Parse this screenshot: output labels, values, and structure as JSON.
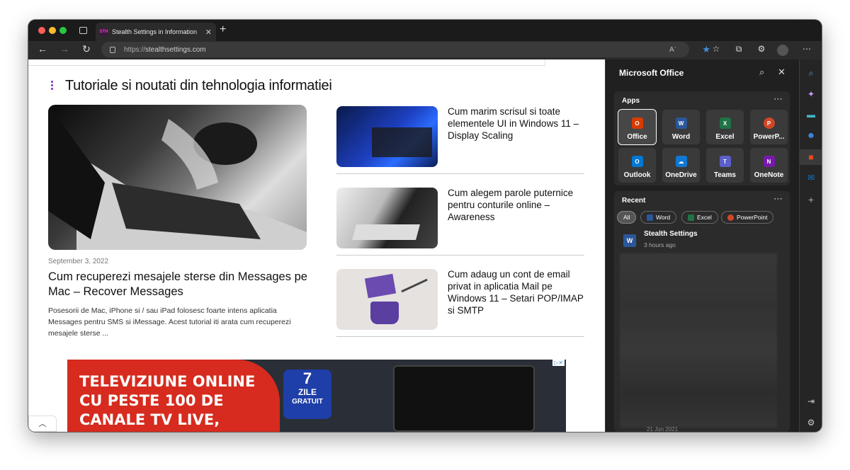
{
  "browser": {
    "tab_title": "Stealth Settings in Information",
    "tab_favicon_text": "STH",
    "url_prefix": "https://",
    "url_host": "stealthsettings.com",
    "read_aloud_label": "Aʾ"
  },
  "page": {
    "section_heading": "Tutoriale si noutati din tehnologia informatiei",
    "featured": {
      "date": "September 3, 2022",
      "title": "Cum recuperezi mesajele sterse din Messages pe Mac – Recover Messages",
      "excerpt": "Posesorii de Mac, iPhone si / sau iPad folosesc foarte intens aplicatia Messages pentru SMS si iMessage. Acest tutorial iti arata cum recuperezi mesajele sterse ..."
    },
    "articles": [
      {
        "title": "Cum marim scrisul si toate elementele UI in Windows 11 – Display Scaling"
      },
      {
        "title": "Cum alegem parole puternice pentru conturile online – Awareness"
      },
      {
        "title": "Cum adaug un cont de email privat in aplicatia Mail pe Windows 11 – Setari POP/IMAP si SMTP"
      }
    ],
    "ad": {
      "line1": "TELEVIZIUNE ONLINE",
      "line2": "CU PESTE 100 DE",
      "line3": "CANALE TV LIVE,",
      "badge_number": "7",
      "badge_line1": "ZILE",
      "badge_line2": "GRATUIT",
      "ad_marker": "▷✕"
    }
  },
  "office_pane": {
    "title": "Microsoft Office",
    "apps_label": "Apps",
    "apps": [
      {
        "label": "Office",
        "color": "#d83b01",
        "glyph": "O"
      },
      {
        "label": "Word",
        "color": "#2b579a",
        "glyph": "W"
      },
      {
        "label": "Excel",
        "color": "#217346",
        "glyph": "X"
      },
      {
        "label": "PowerP...",
        "color": "#d24726",
        "glyph": "P"
      },
      {
        "label": "Outlook",
        "color": "#0078d4",
        "glyph": "O"
      },
      {
        "label": "OneDrive",
        "color": "#0f78d4",
        "glyph": "☁"
      },
      {
        "label": "Teams",
        "color": "#5b5fc7",
        "glyph": "T"
      },
      {
        "label": "OneNote",
        "color": "#7719aa",
        "glyph": "N"
      }
    ],
    "recent_label": "Recent",
    "filters": [
      {
        "label": "All",
        "color": ""
      },
      {
        "label": "Word",
        "color": "#2b579a"
      },
      {
        "label": "Excel",
        "color": "#217346"
      },
      {
        "label": "PowerPoint",
        "color": "#d24726"
      }
    ],
    "recent_items": [
      {
        "name": "Stealth Settings",
        "time": "3 hours ago"
      }
    ],
    "bottom_date": "21 Jun 2021"
  },
  "colors": {
    "accent_purple": "#7b2cc4",
    "edge_blue": "#3c8ee6"
  }
}
